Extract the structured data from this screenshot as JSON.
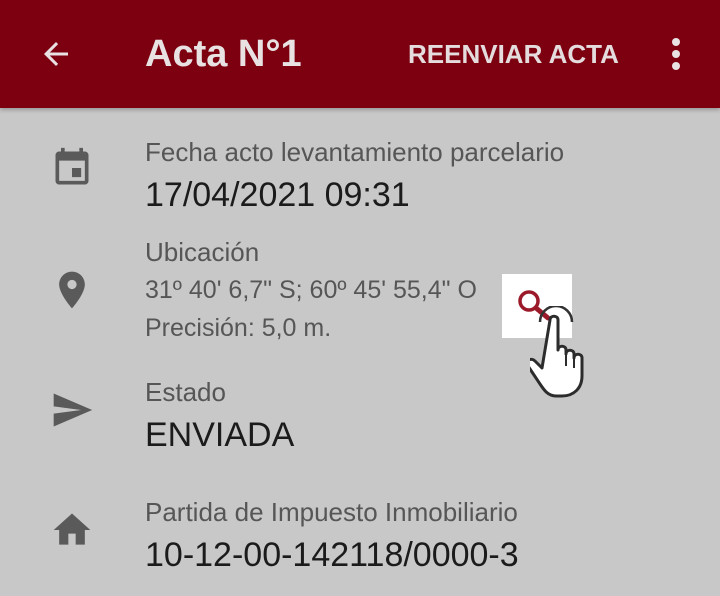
{
  "appbar": {
    "title": "Acta N°1",
    "resend_label": "REENVIAR ACTA",
    "background_color": "#7d0011",
    "back_icon": "arrow-left-icon",
    "menu_icon": "more-vertical-icon"
  },
  "details": {
    "date": {
      "icon": "calendar-icon",
      "label": "Fecha acto levantamiento parcelario",
      "value": "17/04/2021 09:31"
    },
    "location": {
      "icon": "map-pin-icon",
      "label": "Ubicación",
      "coordinates": "31º 40' 6,7\" S; 60º 45' 55,4\" O",
      "precision": "Precisión: 5,0 m.",
      "search_icon": "search-icon",
      "cursor_icon": "hand-pointer-icon",
      "search_color": "#9b1a2a"
    },
    "status": {
      "icon": "send-icon",
      "label": "Estado",
      "value": "ENVIADA"
    },
    "tax": {
      "icon": "home-icon",
      "label": "Partida de Impuesto Inmobiliario",
      "value": "10-12-00-142118/0000-3"
    }
  }
}
